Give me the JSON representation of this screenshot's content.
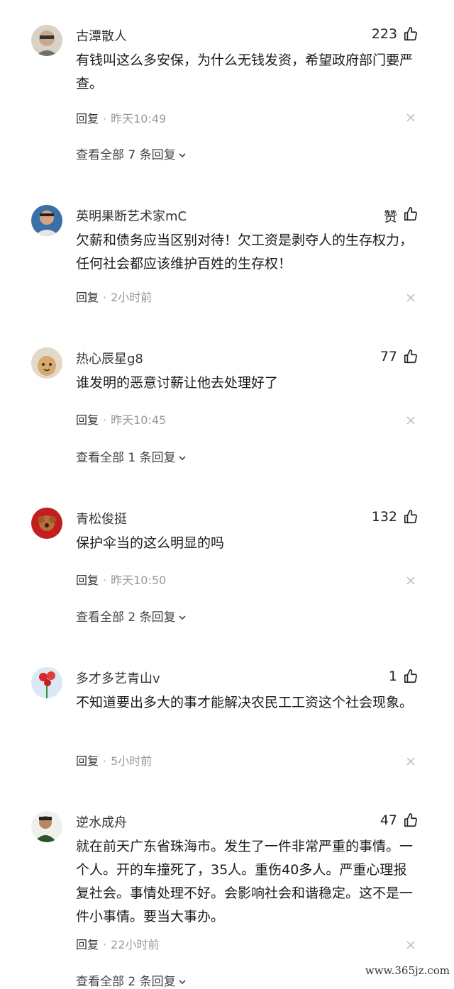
{
  "comments": [
    {
      "name": "古潭散人",
      "likes": "223",
      "text": "有钱叫这么多安保，为什么无钱发资，希望政府部门要严查。",
      "reply": "回复",
      "sep": "·",
      "time": "昨天10:49",
      "more": "查看全部 7 条回复"
    },
    {
      "name": "英明果断艺术家mC",
      "likes": "赞",
      "text": "欠薪和债务应当区别对待！欠工资是剥夺人的生存权力，任何社会都应该维护百姓的生存权！",
      "reply": "回复",
      "sep": "·",
      "time": "2小时前"
    },
    {
      "name": "热心辰星g8",
      "likes": "77",
      "text": "谁发明的恶意讨薪让他去处理好了",
      "reply": "回复",
      "sep": "·",
      "time": "昨天10:45",
      "more": "查看全部 1 条回复"
    },
    {
      "name": "青松俊挺",
      "likes": "132",
      "text": "保护伞当的这么明显的吗",
      "reply": "回复",
      "sep": "·",
      "time": "昨天10:50",
      "more": "查看全部 2 条回复"
    },
    {
      "name": "多才多艺青山v",
      "likes": "1",
      "text": "不知道要出多大的事才能解决农民工工资这个社会现象。",
      "reply": "回复",
      "sep": "·",
      "time": "5小时前"
    },
    {
      "name": "逆水成舟",
      "likes": "47",
      "text": "就在前天广东省珠海市。发生了一件非常严重的事情。一个人。开的车撞死了，35人。重伤40多人。严重心理报复社会。事情处理不好。会影响社会和谐稳定。这不是一件小事情。要当大事办。",
      "reply": "回复",
      "sep": "·",
      "time": "22小时前",
      "more": "查看全部 2 条回复"
    }
  ],
  "watermark": "www.365jz.com",
  "icons": {
    "like": "thumbs-up-icon",
    "close": "close-icon",
    "chevron": "chevron-down-icon"
  }
}
